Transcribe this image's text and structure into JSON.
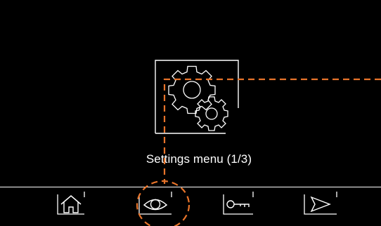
{
  "screen": {
    "caption": "Settings menu (1/3)",
    "settings_tile_icon": "gears-icon"
  },
  "nav_bar": {
    "buttons": [
      {
        "icon": "home-icon",
        "action": "home"
      },
      {
        "icon": "eye-icon",
        "action": "monitor"
      },
      {
        "icon": "key-icon",
        "action": "unlock"
      },
      {
        "icon": "send-icon",
        "action": "send"
      }
    ]
  },
  "annotation": {
    "color": "#e8742a",
    "highlighted": "eye-icon"
  },
  "colors": {
    "background": "#000000",
    "foreground": "#ffffff"
  }
}
